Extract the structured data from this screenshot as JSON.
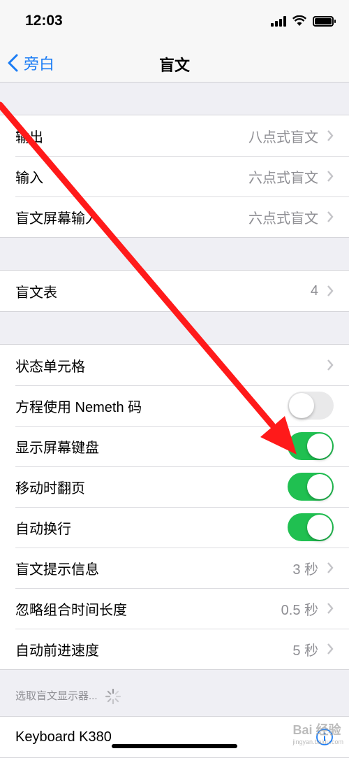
{
  "status_bar": {
    "time": "12:03"
  },
  "nav": {
    "back_label": "旁白",
    "title": "盲文"
  },
  "group1": [
    {
      "label": "输出",
      "value": "八点式盲文"
    },
    {
      "label": "输入",
      "value": "六点式盲文"
    },
    {
      "label": "盲文屏幕输入",
      "value": "六点式盲文"
    }
  ],
  "group2": [
    {
      "label": "盲文表",
      "value": "4"
    }
  ],
  "group3": {
    "status_cell": {
      "label": "状态单元格"
    },
    "nemeth": {
      "label": "方程使用 Nemeth 码",
      "state": "off"
    },
    "onscreen_keyboard": {
      "label": "显示屏幕键盘",
      "state": "on"
    },
    "turn_pages": {
      "label": "移动时翻页",
      "state": "on"
    },
    "word_wrap": {
      "label": "自动换行",
      "state": "on"
    },
    "alert_messages": {
      "label": "盲文提示信息",
      "value": "3 秒"
    },
    "ignore_chord": {
      "label": "忽略组合时间长度",
      "value": "0.5 秒"
    },
    "auto_advance": {
      "label": "自动前进速度",
      "value": "5 秒"
    }
  },
  "footer": {
    "choose_display": "选取盲文显示器..."
  },
  "devices": [
    {
      "label": "Keyboard K380"
    }
  ],
  "watermark": {
    "text": "Bai 经验",
    "sub": "jingyan.baidu.com"
  },
  "colors": {
    "accent": "#1a7cf5",
    "toggle_on": "#20c051",
    "arrow": "#ff1a1a"
  }
}
